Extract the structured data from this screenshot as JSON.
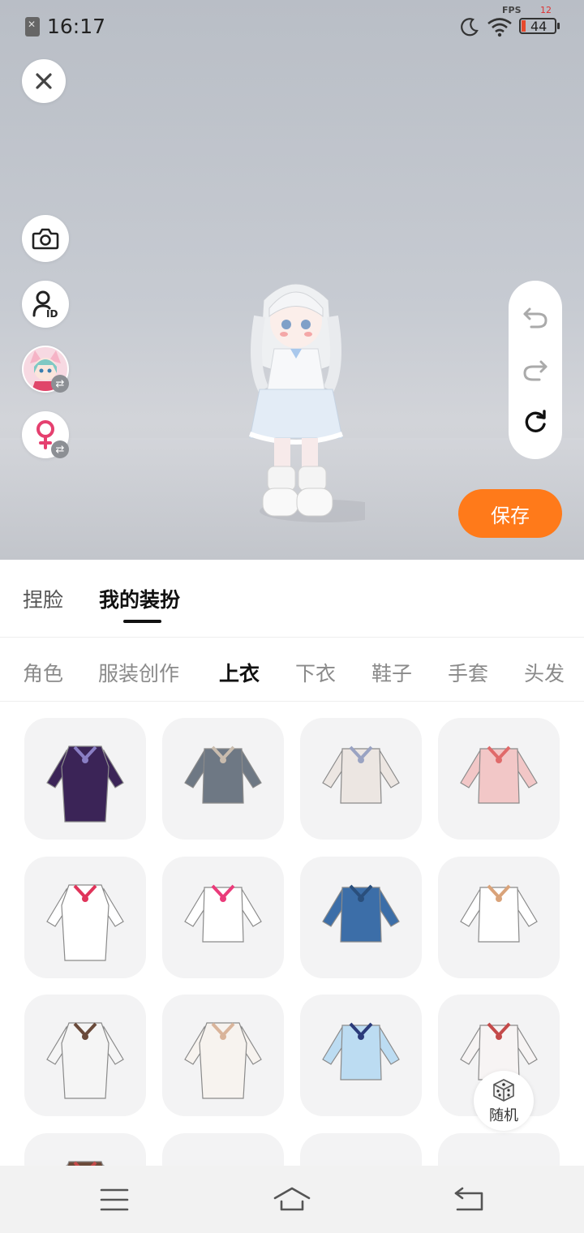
{
  "status_bar": {
    "time": "16:17",
    "fps_label": "FPS",
    "fps_value": "12",
    "battery": "44"
  },
  "viewport": {
    "left_buttons": [
      "close-icon",
      "camera-icon",
      "profile-id-icon",
      "avatar-swap",
      "female-swap-icon"
    ],
    "history": [
      "undo-icon",
      "redo-icon",
      "reset-icon"
    ],
    "save_label": "保存"
  },
  "main_tabs": [
    {
      "label": "捏脸",
      "active": false
    },
    {
      "label": "我的装扮",
      "active": true
    }
  ],
  "sub_tabs": [
    {
      "label": "角色",
      "active": false
    },
    {
      "label": "服装创作",
      "active": false
    },
    {
      "label": "上衣",
      "active": true
    },
    {
      "label": "下衣",
      "active": false
    },
    {
      "label": "鞋子",
      "active": false
    },
    {
      "label": "手套",
      "active": false
    },
    {
      "label": "头发",
      "active": false
    }
  ],
  "items": [
    {
      "name": "purple-sweater-plaid-skirt",
      "color": "#3b2457",
      "accent": "#8a7fc4"
    },
    {
      "name": "gray-jacket-pleated-skirt",
      "color": "#6e7884",
      "accent": "#c9bcae"
    },
    {
      "name": "white-cardigan",
      "color": "#ece6e2",
      "accent": "#9aa3c2"
    },
    {
      "name": "pink-crop-top",
      "color": "#f2c7c7",
      "accent": "#e06a6a"
    },
    {
      "name": "white-shirt-red-bow",
      "color": "#ffffff",
      "accent": "#e0345a"
    },
    {
      "name": "sailor-shirt-pink-bow",
      "color": "#ffffff",
      "accent": "#ea3b7a"
    },
    {
      "name": "blue-blazer",
      "color": "#3c6ea8",
      "accent": "#2a4f7c"
    },
    {
      "name": "white-ruffle-blouse",
      "color": "#ffffff",
      "accent": "#d9a37a"
    },
    {
      "name": "white-coat-dress",
      "color": "#f5f5f5",
      "accent": "#6a4a3a"
    },
    {
      "name": "white-long-dress",
      "color": "#f7f3ef",
      "accent": "#d9b49a"
    },
    {
      "name": "light-blue-shirt-tie",
      "color": "#bcdcf2",
      "accent": "#2b3b7a"
    },
    {
      "name": "white-lace-dress",
      "color": "#f7f4f4",
      "accent": "#c44a4a"
    }
  ],
  "random_label": "随机",
  "nav": [
    "menu-icon",
    "home-icon",
    "back-icon"
  ]
}
